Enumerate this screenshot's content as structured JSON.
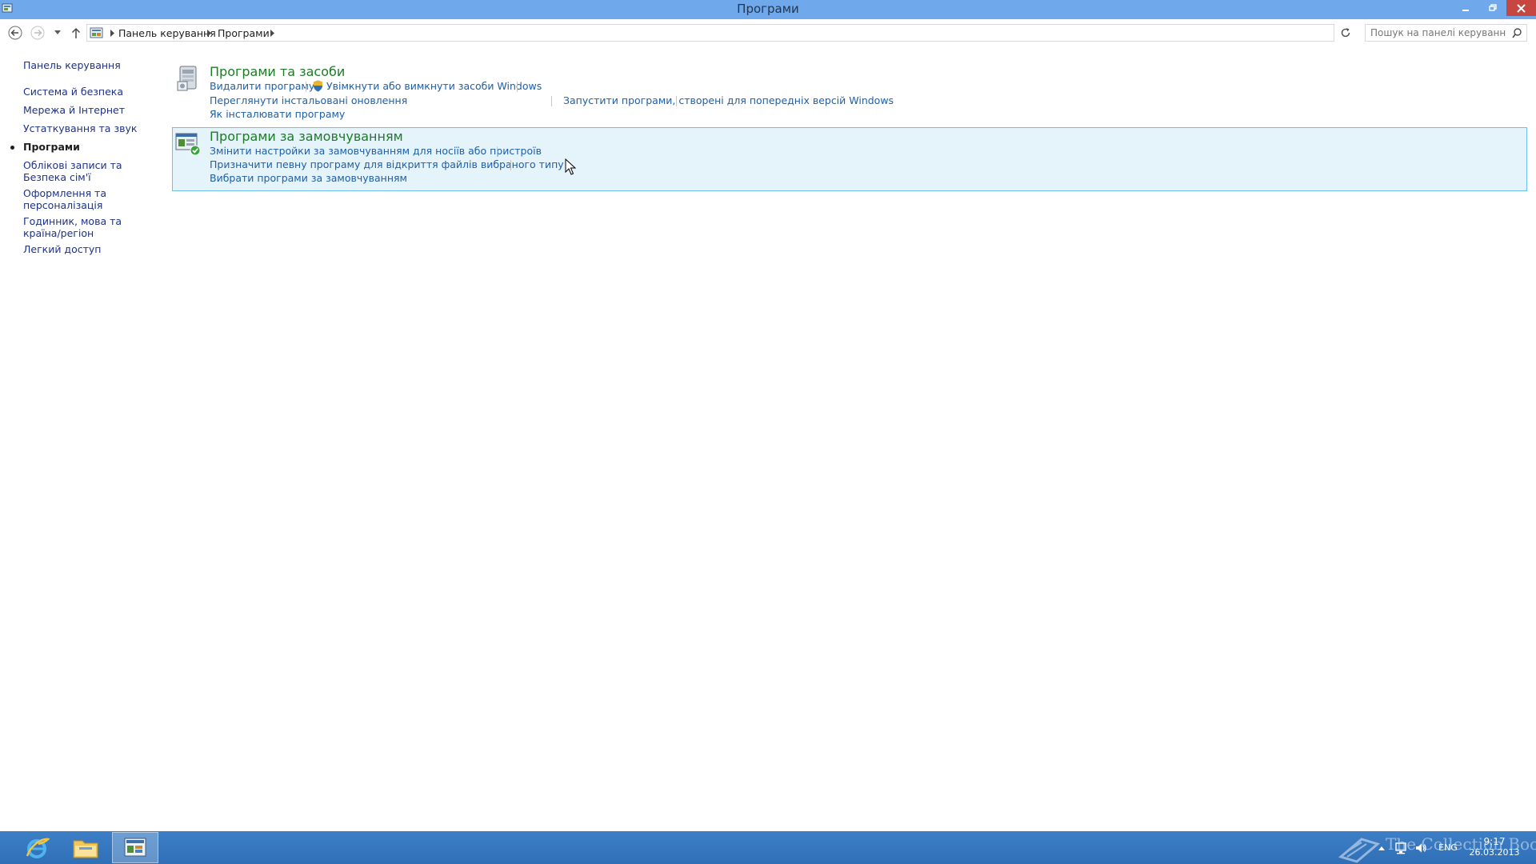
{
  "window": {
    "title": "Програми",
    "minimize_icon": "minimize-icon",
    "maximize_icon": "restore-icon",
    "close_icon": "close-icon"
  },
  "address_bar": {
    "breadcrumb": [
      "Панель керування",
      "Програми"
    ],
    "search_placeholder": "Пошук на панелі керування"
  },
  "sidebar": {
    "home": "Панель керування",
    "items": [
      {
        "label": "Система й безпека"
      },
      {
        "label": "Мережа й Інтернет"
      },
      {
        "label": "Устаткування та звук"
      },
      {
        "label": "Програми",
        "active": true
      },
      {
        "label": "Облікові записи та Безпека сім'ї"
      },
      {
        "label": "Оформлення та персоналізація"
      },
      {
        "label": "Годинник, мова та країна/регіон"
      },
      {
        "label": "Легкий доступ"
      }
    ]
  },
  "categories": [
    {
      "title": "Програми та засоби",
      "tasks": [
        "Видалити програму",
        "Увімкнути або вимкнути засоби Windows",
        "Переглянути інстальовані оновлення",
        "Запустити програми, створені для попередніх версій Windows",
        "Як інсталювати програму"
      ]
    },
    {
      "title": "Програми за замовчуванням",
      "tasks": [
        "Змінити настройки за замовчуванням для носіїв або пристроїв",
        "Призначити певну програму для відкриття файлів вибраного типу",
        "Вибрати програми за замовчуванням"
      ]
    }
  ],
  "taskbar": {
    "apps": [
      "internet-explorer-icon",
      "file-explorer-icon",
      "control-panel-icon"
    ],
    "language": "ENG",
    "time": "9:17",
    "date": "26.03.2013"
  },
  "watermark": {
    "text": "The Collection Book"
  },
  "colors": {
    "titlebar": "#6fa9ec",
    "category_title": "#1e7b26",
    "link": "#1e5fa8",
    "taskbar": "#3578c0",
    "hover_bg": "#e5f3fb"
  }
}
